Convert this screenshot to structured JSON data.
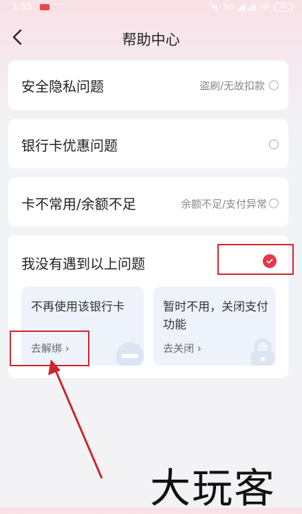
{
  "status_bar": {
    "time": "1:55",
    "dots": "···",
    "signal": "5G",
    "battery": "80"
  },
  "header": {
    "title": "帮助中心"
  },
  "questions": [
    {
      "label": "安全隐私问题",
      "sub": "盗刷/无故扣款"
    },
    {
      "label": "银行卡优惠问题",
      "sub": ""
    },
    {
      "label": "卡不常用/余额不足",
      "sub": "余额不足/支付异常"
    }
  ],
  "other": {
    "label": "我没有遇到以上问题",
    "options": [
      {
        "title": "不再使用该银行卡",
        "link": "去解绑",
        "link_arrow": "›"
      },
      {
        "title": "暂时不用，关闭支付功能",
        "link": "去关闭",
        "link_arrow": "›"
      }
    ]
  },
  "watermark": "大玩客",
  "colors": {
    "accent": "#e8364a",
    "annotation": "#d0242c"
  }
}
